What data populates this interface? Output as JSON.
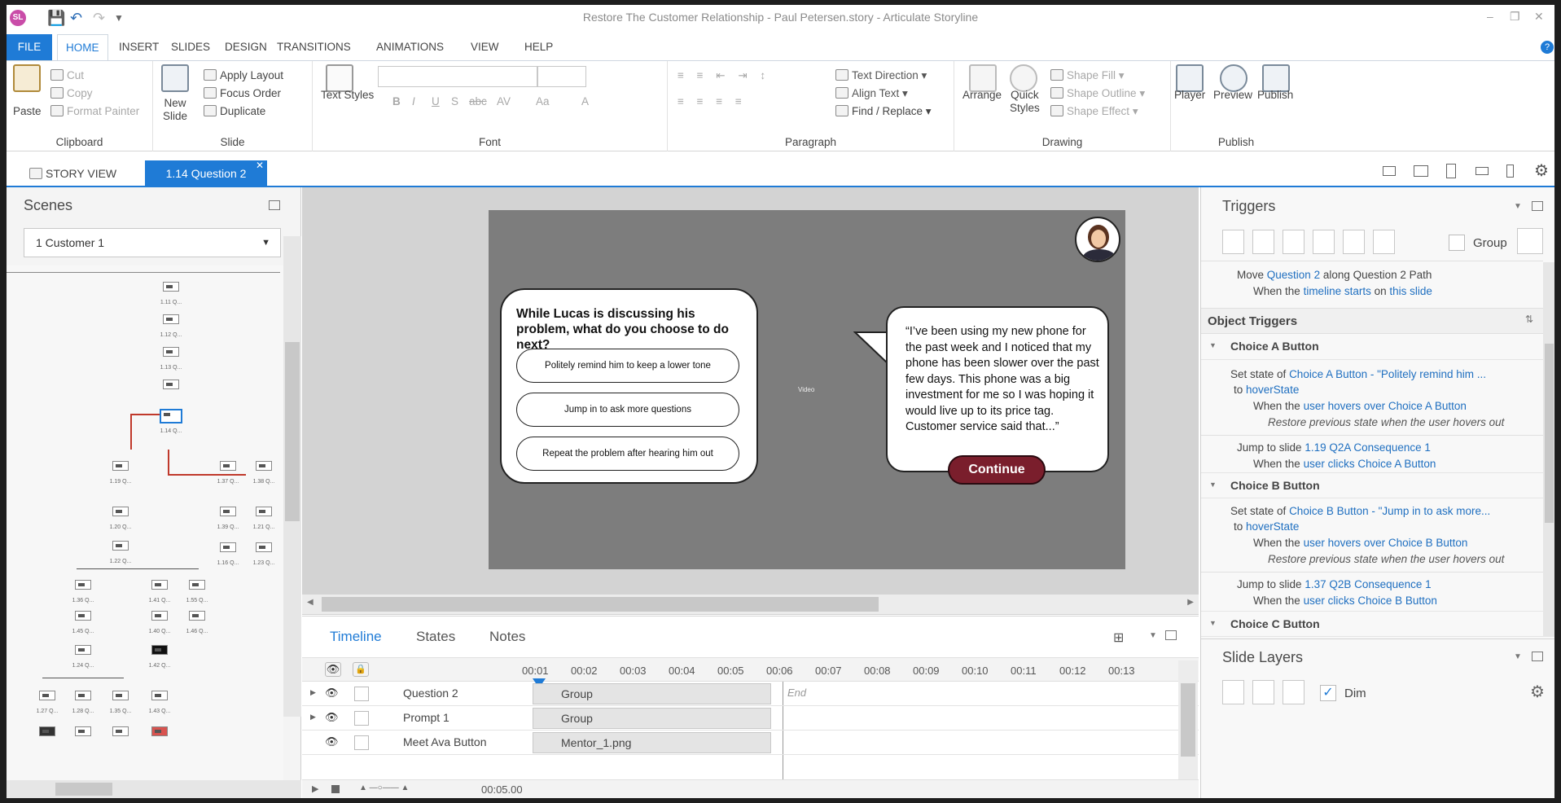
{
  "window": {
    "title": "Restore The Customer Relationship - Paul Petersen.story - Articulate Storyline",
    "logo": "SL"
  },
  "ribbon_tabs": [
    "FILE",
    "HOME",
    "INSERT",
    "SLIDES",
    "DESIGN",
    "TRANSITIONS",
    "ANIMATIONS",
    "VIEW",
    "HELP"
  ],
  "clipboard": {
    "paste": "Paste",
    "cut": "Cut",
    "copy": "Copy",
    "format_painter": "Format Painter",
    "label": "Clipboard"
  },
  "slide_group": {
    "new_slide": "New",
    "new_slide2": "Slide",
    "apply_layout": "Apply Layout",
    "focus_order": "Focus Order",
    "duplicate": "Duplicate",
    "label": "Slide"
  },
  "font_group": {
    "text_styles": "Text Styles",
    "label": "Font",
    "bold": "B",
    "italic": "I",
    "underline": "U",
    "shadow": "S",
    "strike": "abc",
    "spacing": "AV",
    "case": "Aa",
    "color": "A"
  },
  "paragraph_group": {
    "text_direction": "Text Direction",
    "align_text": "Align Text",
    "find_replace": "Find / Replace",
    "label": "Paragraph"
  },
  "drawing_group": {
    "arrange": "Arrange",
    "quick_styles": "Quick",
    "quick_styles2": "Styles",
    "shape_fill": "Shape Fill",
    "shape_outline": "Shape Outline",
    "shape_effect": "Shape Effect",
    "label": "Drawing"
  },
  "publish_group": {
    "player": "Player",
    "preview": "Preview",
    "publish": "Publish",
    "label": "Publish"
  },
  "doc_tabs": {
    "story_view": "STORY VIEW",
    "active": "1.14 Question 2"
  },
  "scenes": {
    "title": "Scenes",
    "selected": "1 Customer 1",
    "labels": [
      "1.11 Q...",
      "1.12 Q...",
      "1.13 Q...",
      "1.14 Q...",
      "1.19 Q...",
      "1.20 Q...",
      "1.22 Q...",
      "1.37 Q...",
      "1.38 Q...",
      "1.39 Q...",
      "1.21 Q...",
      "1.16 Q...",
      "1.23 Q...",
      "1.36 Q...",
      "1.41 Q...",
      "1.55 Q...",
      "1.45 Q...",
      "1.40 Q...",
      "1.46 Q...",
      "1.24 Q...",
      "1.42 Q...",
      "1.27 Q...",
      "1.28 Q...",
      "1.35 Q...",
      "1.43 Q..."
    ]
  },
  "slide": {
    "question": "While Lucas is discussing his problem, what do you choose to do next?",
    "choices": [
      "Politely remind him to keep a lower tone",
      "Jump in to ask more questions",
      "Repeat the problem after hearing him out"
    ],
    "speech": "“I’ve been using my new phone for the past week and I noticed that my phone has been slower over the past few days. This phone was a big investment for me so I was hoping it would live up to its price tag. Customer service said that...”",
    "continue": "Continue",
    "video_label": "Video"
  },
  "timeline": {
    "tabs": [
      "Timeline",
      "States",
      "Notes"
    ],
    "ticks": [
      "00:01",
      "00:02",
      "00:03",
      "00:04",
      "00:05",
      "00:06",
      "00:07",
      "00:08",
      "00:09",
      "00:10",
      "00:11",
      "00:12",
      "00:13"
    ],
    "end_label": "End",
    "rows": [
      {
        "name": "Question 2",
        "bar": "Group"
      },
      {
        "name": "Prompt 1",
        "bar": "Group"
      },
      {
        "name": "Meet Ava Button",
        "bar": "Mentor_1.png"
      }
    ],
    "duration": "00:05.00"
  },
  "triggers": {
    "title": "Triggers",
    "group_label": "Group",
    "top": {
      "a": "Move",
      "b": "Question 2",
      "c": "along Question 2 Path",
      "d": "When the",
      "e": "timeline starts",
      "f": "on",
      "g": "this slide"
    },
    "object_triggers": "Object Triggers",
    "choice_a": {
      "name": "Choice A Button",
      "set_state": "Set state of",
      "obj": "Choice A Button",
      "detail": " - \"Politely remind him ...",
      "to": "to",
      "state": "hoverState",
      "when": "When the",
      "user_hovers": "user hovers over",
      "restore": "Restore previous state when the user hovers out",
      "jump": "Jump to slide",
      "slide": "1.19 Q2A Consequence 1",
      "user_clicks": "user clicks"
    },
    "choice_b": {
      "name": "Choice B Button",
      "obj": "Choice B Button",
      "detail": " - \"Jump in to ask more...",
      "slide": "1.37 Q2B Consequence 1"
    },
    "choice_c": {
      "name": "Choice C Button"
    },
    "slide_layers": "Slide Layers",
    "dim": "Dim"
  },
  "colors": {
    "accent": "#1f7bd6",
    "link": "#1f6fc0",
    "continue": "#7a1e2c"
  }
}
